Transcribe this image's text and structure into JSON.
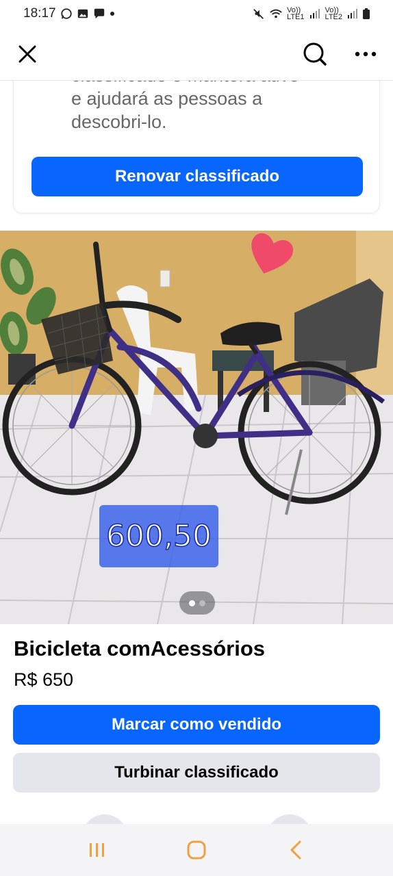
{
  "status_bar": {
    "time": "18:17",
    "sim1_label": "LTE1",
    "sim2_label": "LTE2",
    "volte_label": "Vo))"
  },
  "top_bar": {
    "close_icon": "close-icon",
    "search_icon": "search-icon",
    "more_icon": "more-icon"
  },
  "renew_card": {
    "text_partial": "classificado o manterá ativo",
    "text_line2": "e ajudará as pessoas a",
    "text_line3": "descobri-lo.",
    "button_label": "Renovar classificado"
  },
  "listing": {
    "image_price_overlay": "600,50",
    "photo_index": 1,
    "photo_count": 2,
    "title": "Bicicleta comAcessórios",
    "price": "R$ 650"
  },
  "actions": {
    "mark_sold_label": "Marcar como vendido",
    "boost_label": "Turbinar classificado"
  },
  "colors": {
    "primary": "#0866ff",
    "secondary_bg": "#e4e6eb",
    "nav_icon": "#f0a040"
  }
}
